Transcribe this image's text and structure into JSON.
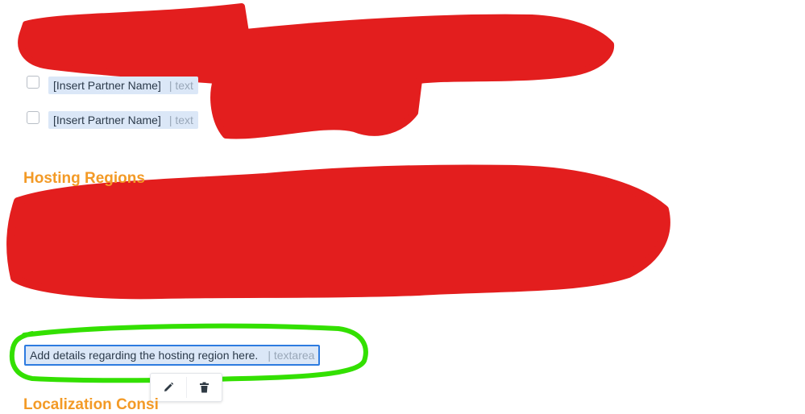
{
  "partner_rows": [
    {
      "label": "[Insert Partner Name]",
      "type": "| text"
    },
    {
      "label": "[Insert Partner Name]",
      "type": "| text"
    }
  ],
  "section": {
    "title": "Hosting Regions",
    "next_title_partial": "Localization Consi"
  },
  "selected_field": {
    "text": "Add details regarding the hosting region here.",
    "type": "| textarea"
  },
  "toolbar": {
    "edit_icon": "pencil-icon",
    "delete_icon": "trash-icon"
  },
  "colors": {
    "heading": "#f39a26",
    "chip_bg": "#dbe7f7",
    "selected_border": "#2d7be0",
    "redaction": "#e31e1e",
    "highlight_circle": "#33e000"
  }
}
